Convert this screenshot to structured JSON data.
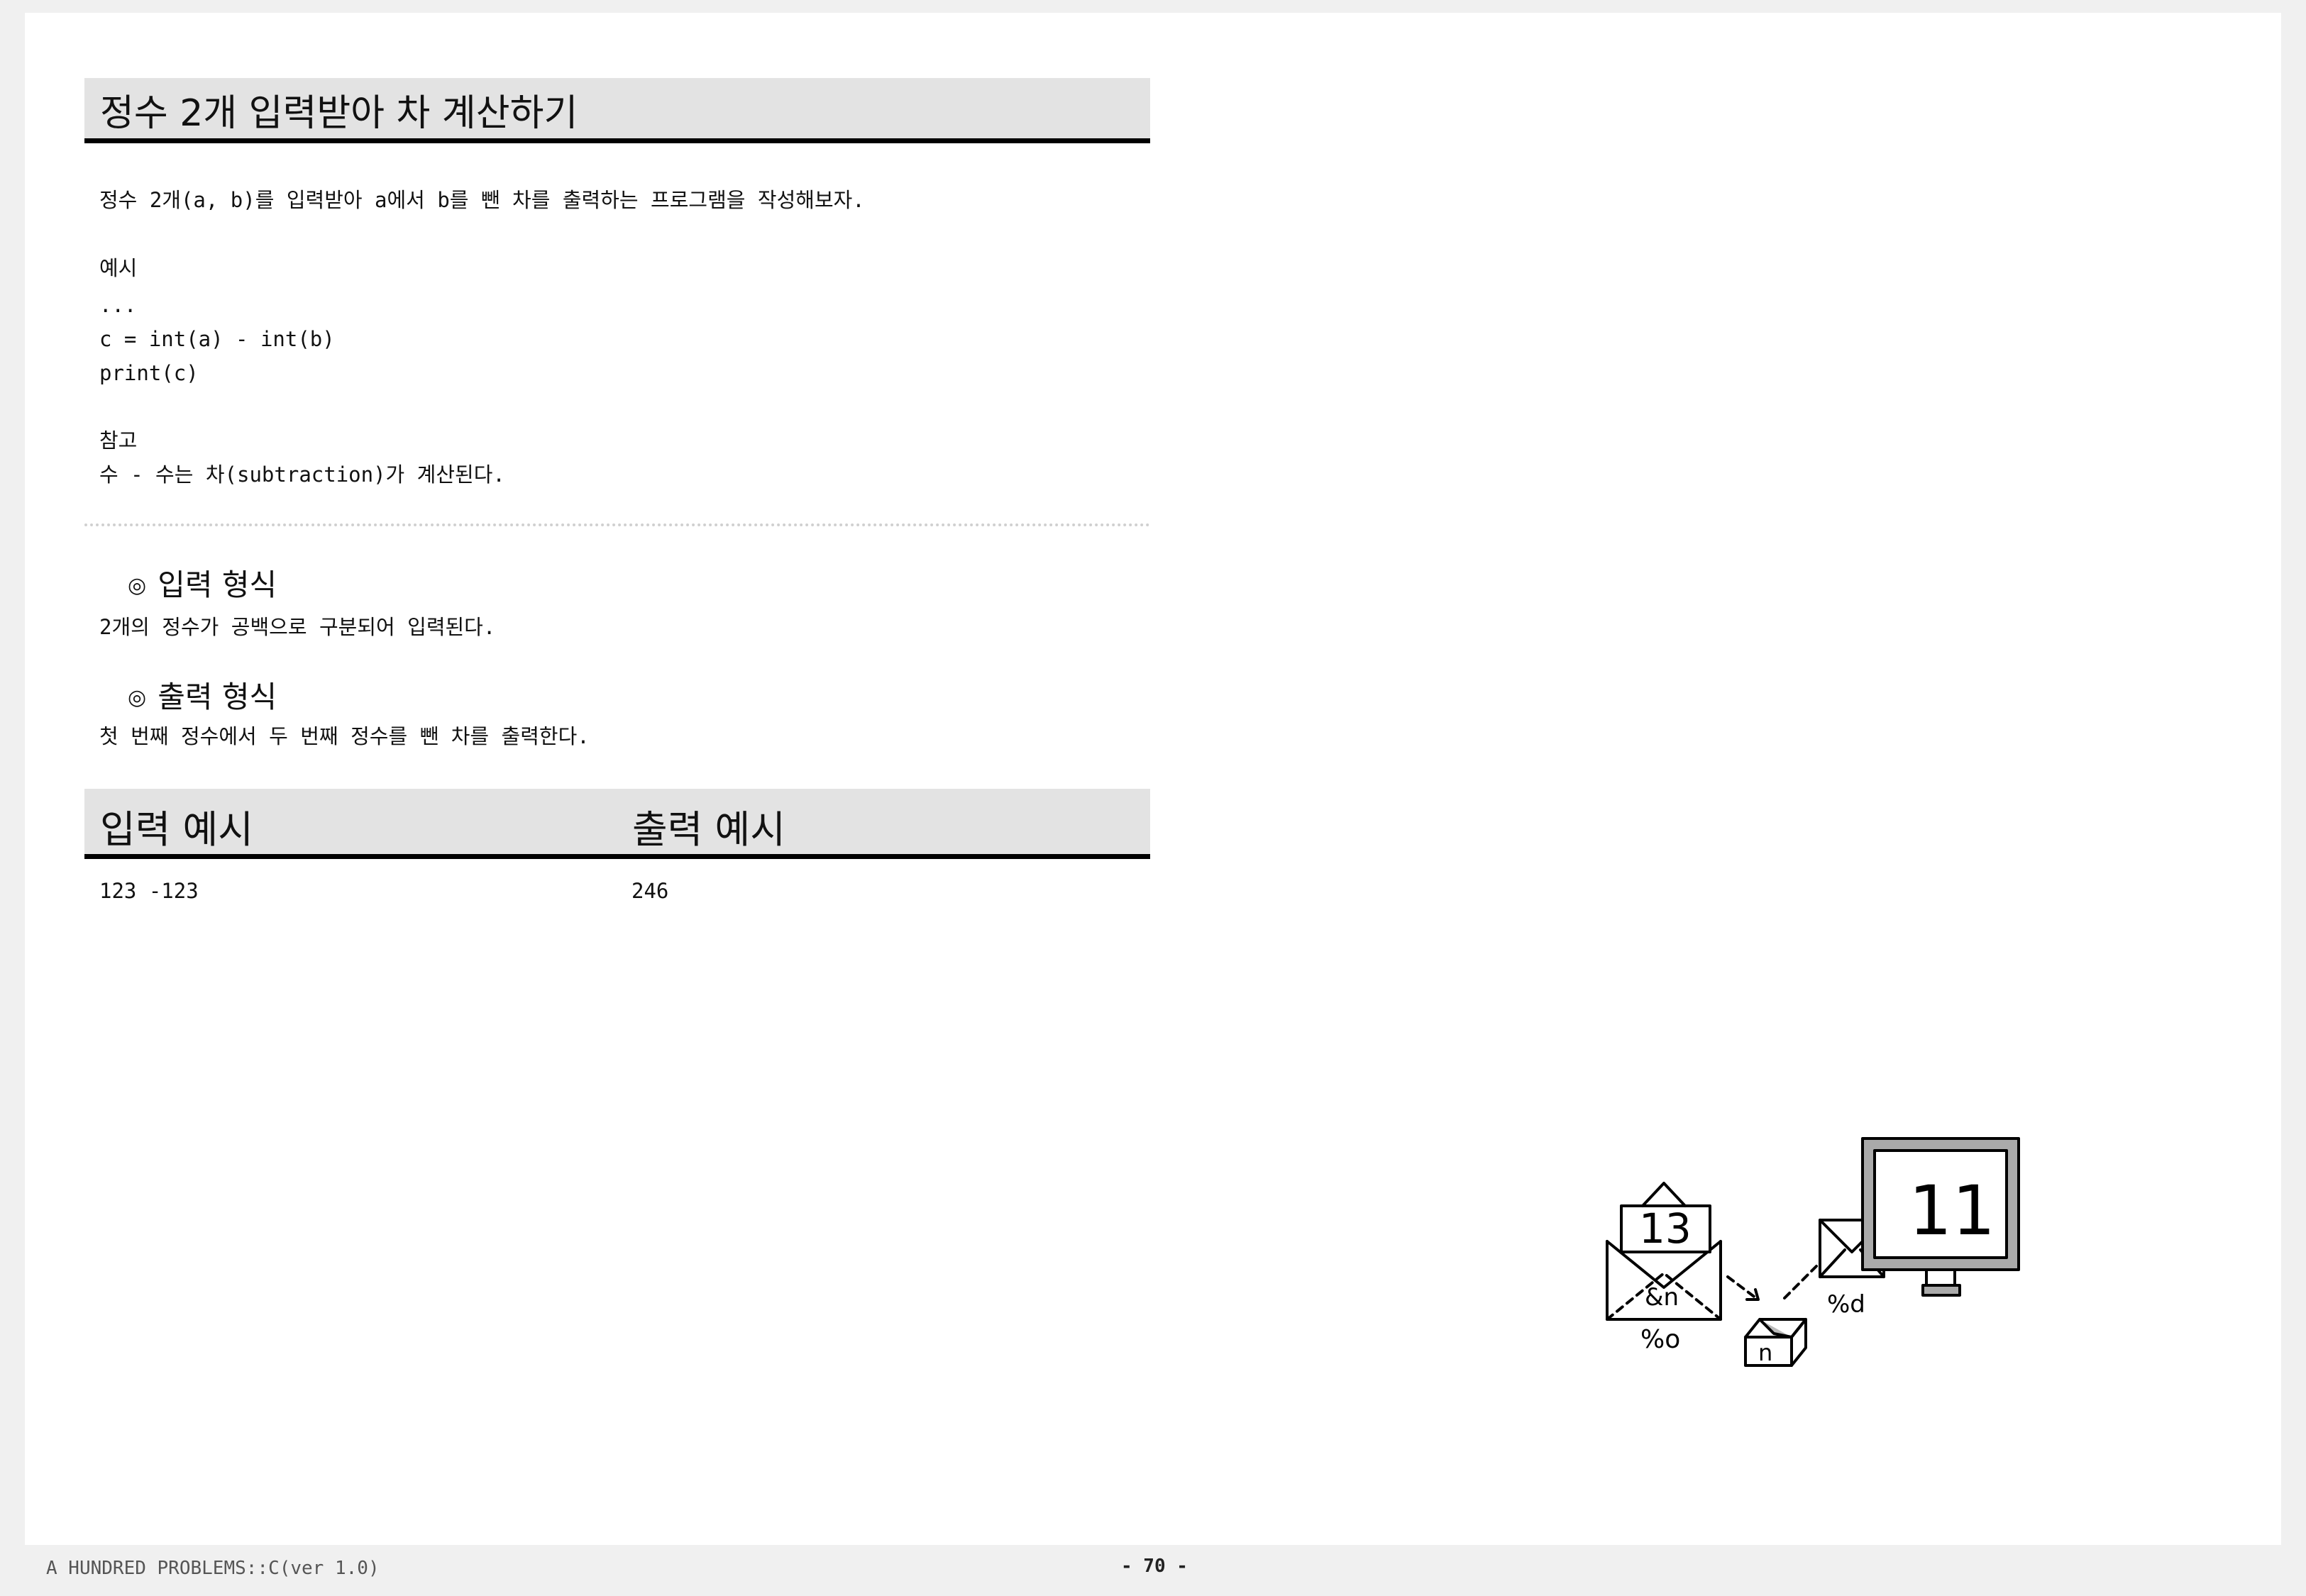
{
  "title": "정수 2개 입력받아 차 계산하기",
  "description": "정수 2개(a, b)를 입력받아 a에서 b를 뺀 차를 출력하는 프로그램을 작성해보자.",
  "example": {
    "label": "예시",
    "lines": [
      "...",
      "c = int(a) - int(b)",
      "print(c)"
    ]
  },
  "note": {
    "label": "참고",
    "text": "수 - 수는 차(subtraction)가 계산된다."
  },
  "input_format": {
    "bullet": "◎",
    "heading": "입력 형식",
    "text": "2개의 정수가 공백으로 구분되어 입력된다."
  },
  "output_format": {
    "bullet": "◎",
    "heading": "출력 형식",
    "text": "첫 번째 정수에서 두 번째 정수를 뺀 차를 출력한다."
  },
  "examples_table": {
    "input_header": "입력 예시",
    "output_header": "출력 예시",
    "input_value": "123 -123",
    "output_value": "246"
  },
  "illustration": {
    "envelope_number": "13",
    "envelope_label_1": "&n",
    "envelope_label_2": "%o",
    "box_label": "n",
    "mail_label": "%d",
    "monitor_number": "11"
  },
  "footer": {
    "left": "A HUNDRED PROBLEMS::C(ver 1.0)",
    "page": "- 70 -"
  }
}
